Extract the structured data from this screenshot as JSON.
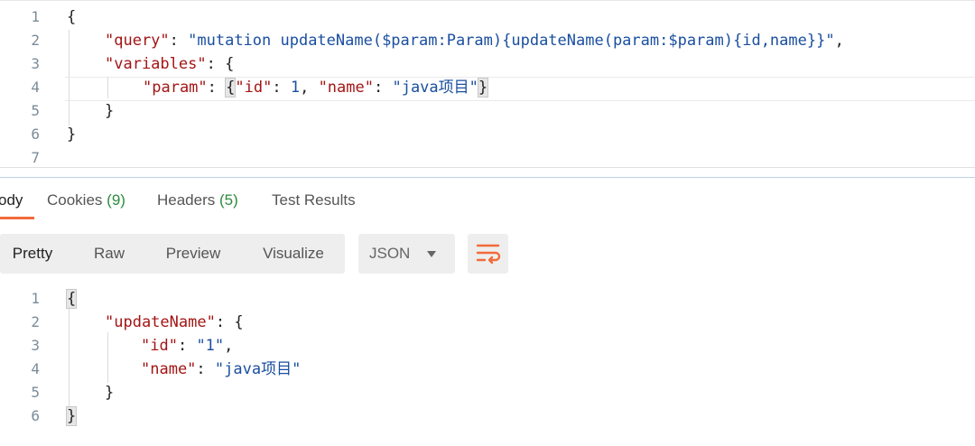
{
  "request_editor": {
    "line_numbers": [
      "1",
      "2",
      "3",
      "4",
      "5",
      "6",
      "7"
    ],
    "line1": {
      "brace": "{"
    },
    "line2": {
      "key": "\"query\"",
      "colon": ": ",
      "value": "\"mutation updateName($param:Param){updateName(param:$param){id,name}}\"",
      "comma": ","
    },
    "line3": {
      "key": "\"variables\"",
      "colon": ": ",
      "brace": "{"
    },
    "line4": {
      "key": "\"param\"",
      "colon": ": ",
      "brace_open": "{",
      "k1": "\"id\"",
      "c1": ": ",
      "v1": "1",
      "sep": ", ",
      "k2": "\"name\"",
      "c2": ": ",
      "v2": "\"java项目\"",
      "brace_close": "}"
    },
    "line5": {
      "brace": "}"
    },
    "line6": {
      "brace": "}"
    }
  },
  "response_tabs": {
    "body": "ody",
    "cookies": "Cookies",
    "cookies_count": "(9)",
    "headers": "Headers",
    "headers_count": "(5)",
    "test_results": "Test Results"
  },
  "toolbar": {
    "pretty": "Pretty",
    "raw": "Raw",
    "preview": "Preview",
    "visualize": "Visualize",
    "format": "JSON"
  },
  "response_editor": {
    "line_numbers": [
      "1",
      "2",
      "3",
      "4",
      "5",
      "6"
    ],
    "line1": {
      "brace": "{"
    },
    "line2": {
      "key": "\"updateName\"",
      "colon": ": ",
      "brace": "{"
    },
    "line3": {
      "key": "\"id\"",
      "colon": ": ",
      "value": "\"1\"",
      "comma": ","
    },
    "line4": {
      "key": "\"name\"",
      "colon": ": ",
      "value": "\"java项目\""
    },
    "line5": {
      "brace": "}"
    },
    "line6": {
      "brace": "}"
    }
  },
  "colors": {
    "accent": "#f26b3a",
    "count_green": "#2e8b3d",
    "json_key": "#a31515",
    "json_value": "#1a4fa0"
  },
  "icons": {
    "wrap": "wrap-lines-icon",
    "dropdown": "chevron-down-icon"
  }
}
